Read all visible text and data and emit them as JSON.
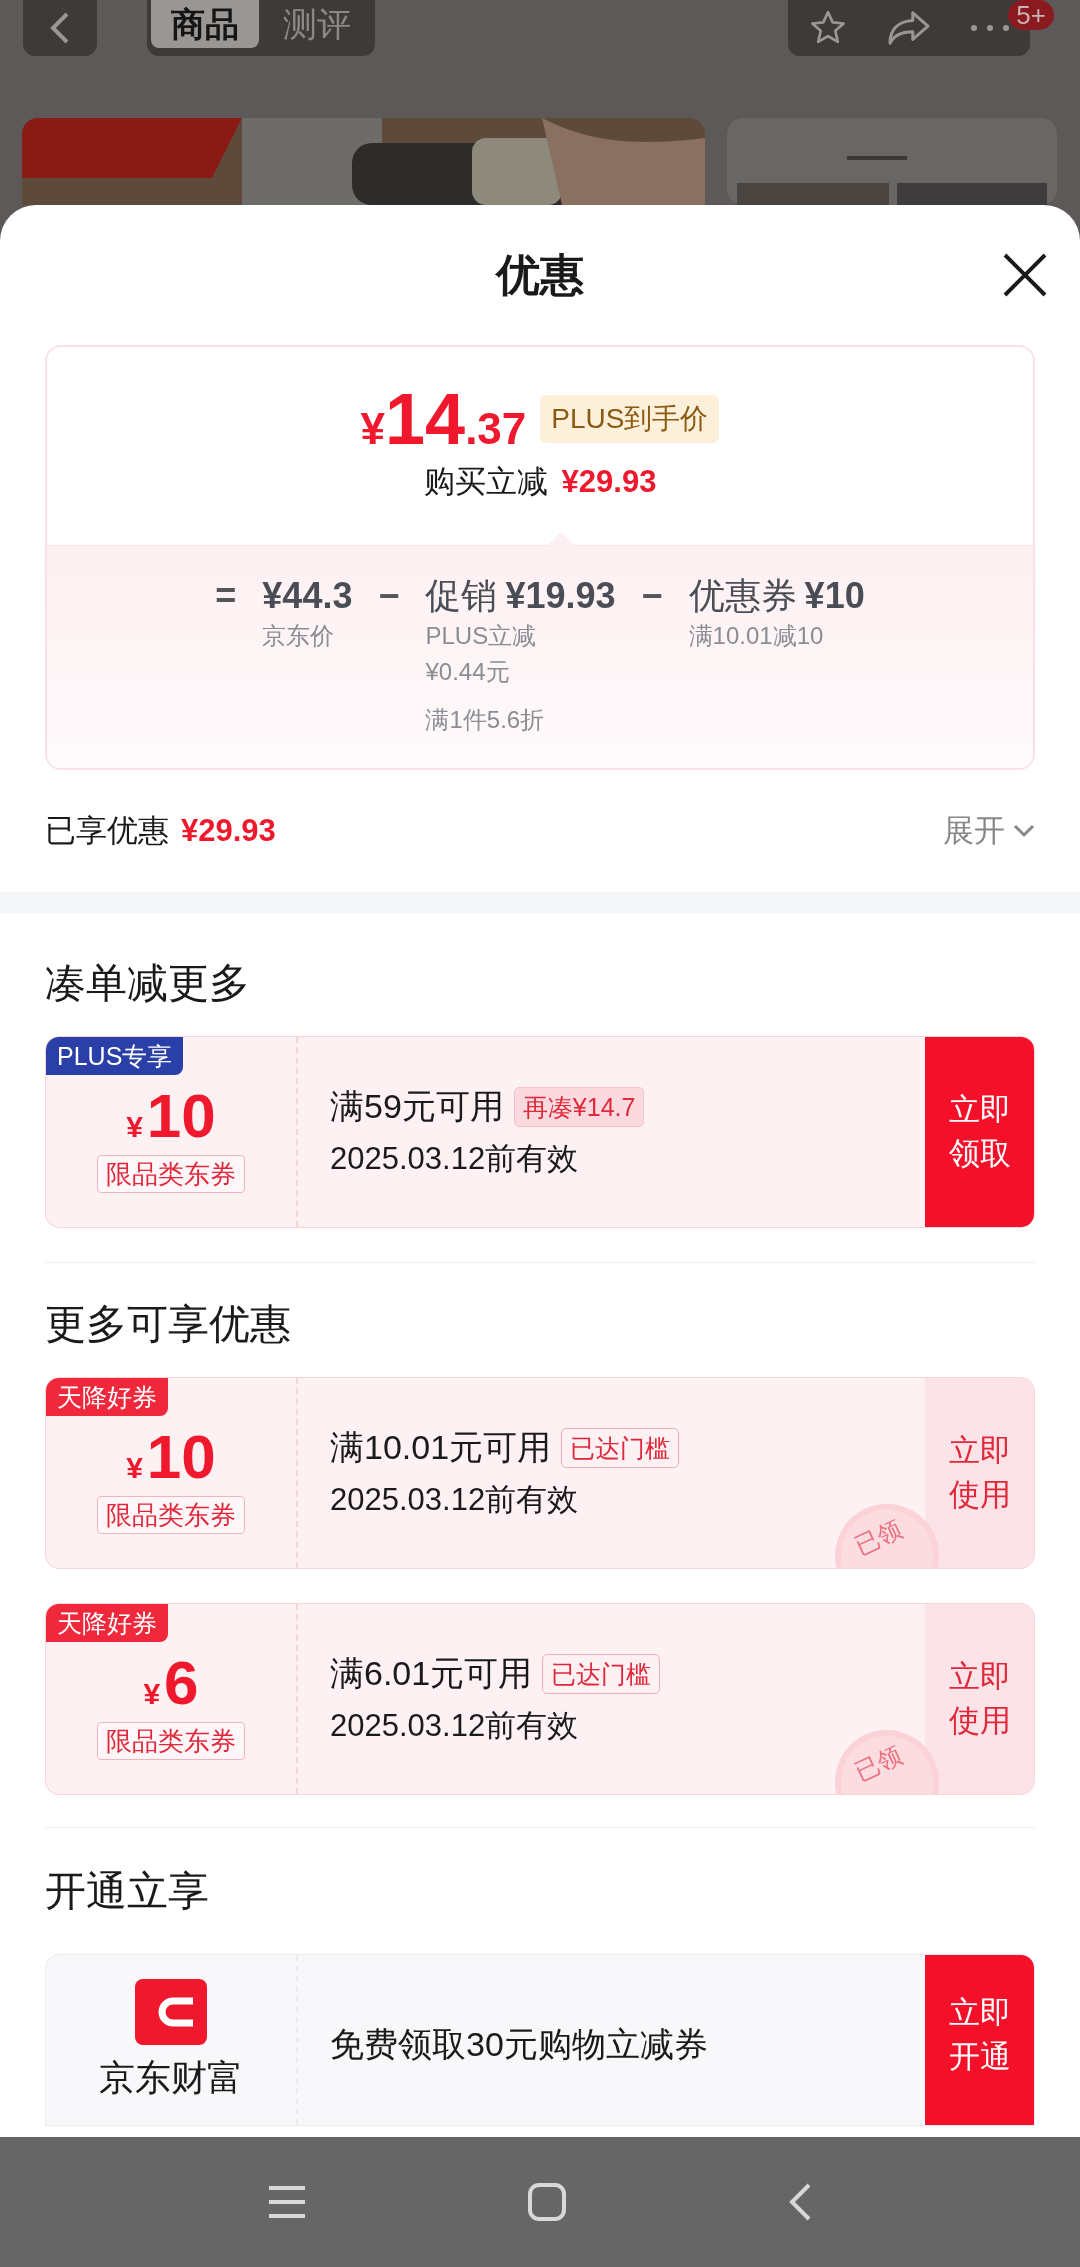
{
  "top_bar": {
    "tabs": [
      {
        "label": "商品",
        "selected": true
      },
      {
        "label": "测评",
        "selected": false
      }
    ],
    "badge": "5+"
  },
  "sheet": {
    "title": "优惠"
  },
  "price_card": {
    "symbol": "¥",
    "integer": "14",
    "decimal": ".37",
    "tag": "PLUS到手价",
    "saving_label": "购买立减",
    "saving_amount": "¥29.93",
    "breakdown": [
      {
        "op": "=",
        "amount": "¥44.3",
        "notes": [
          "京东价"
        ]
      },
      {
        "op": "−",
        "label": "促销",
        "amount": "¥19.93",
        "notes": [
          "PLUS立减",
          "¥0.44元"
        ],
        "extra": "满1件5.6折"
      },
      {
        "op": "−",
        "label": "优惠券",
        "amount": "¥10",
        "notes": [
          "满10.01减10"
        ]
      }
    ]
  },
  "enjoyed": {
    "label": "已享优惠",
    "amount": "¥29.93",
    "toggle": "展开"
  },
  "sections": [
    {
      "heading": "凑单减更多",
      "coupons": [
        {
          "tag": "PLUS专享",
          "color": "#2a3fa8",
          "symbol": "¥",
          "amount": "10",
          "scope": "限品类东券",
          "condition": "满59元可用",
          "note": {
            "text": "再凑¥14.7",
            "kind": "shortfall"
          },
          "validity": "2025.03.12前有效",
          "button": [
            "立即",
            "领取"
          ],
          "kind": "claim",
          "claimed": false
        }
      ]
    },
    {
      "heading": "更多可享优惠",
      "coupons": [
        {
          "tag": "天降好券",
          "color": "#f0283c",
          "symbol": "¥",
          "amount": "10",
          "scope": "限品类东券",
          "condition": "满10.01元可用",
          "note": {
            "text": "已达门槛",
            "kind": "reached"
          },
          "validity": "2025.03.12前有效",
          "button": [
            "立即",
            "使用"
          ],
          "kind": "use",
          "claimed": true,
          "stamp": "已领"
        },
        {
          "tag": "天降好券",
          "color": "#f0283c",
          "symbol": "¥",
          "amount": "6",
          "scope": "限品类东券",
          "condition": "满6.01元可用",
          "note": {
            "text": "已达门槛",
            "kind": "reached"
          },
          "validity": "2025.03.12前有效",
          "button": [
            "立即",
            "使用"
          ],
          "kind": "use",
          "claimed": true,
          "stamp": "已领"
        }
      ]
    }
  ],
  "open_section": {
    "heading": "开通立享",
    "brand": "京东财富",
    "offer": "免费领取30元购物立减券",
    "button": [
      "立即",
      "开通"
    ]
  }
}
